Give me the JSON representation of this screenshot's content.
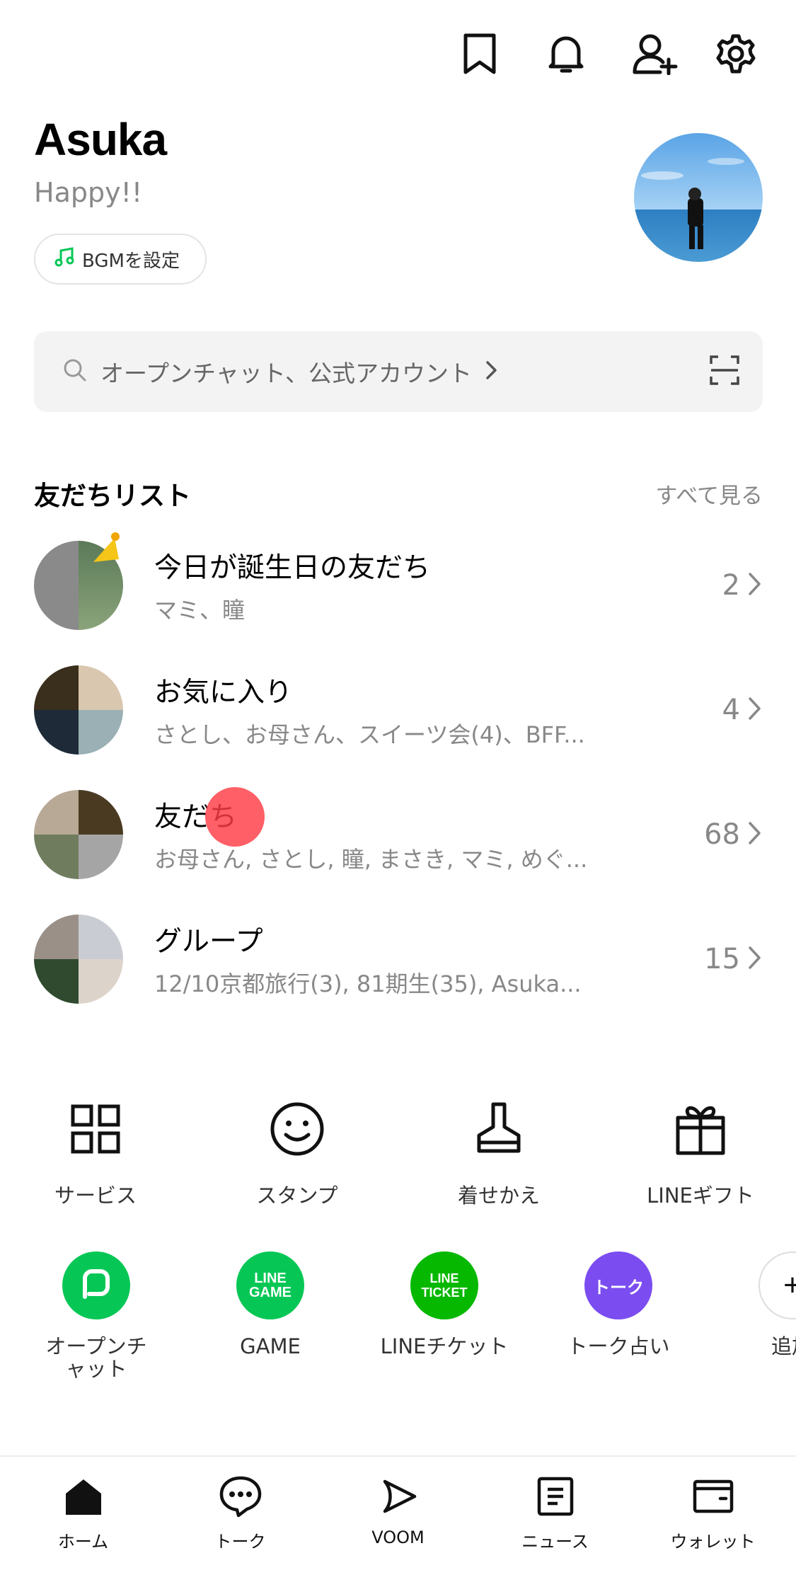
{
  "header": {
    "icons": [
      "bookmark-icon",
      "bell-icon",
      "add-friend-icon",
      "gear-icon"
    ]
  },
  "profile": {
    "name": "Asuka",
    "status": "Happy!!",
    "bgm_label": "BGMを設定"
  },
  "search": {
    "text": "オープンチャット、公式アカウント"
  },
  "friends_section": {
    "title": "友だちリスト",
    "see_all": "すべて見る",
    "rows": [
      {
        "name": "今日が誕生日の友だち",
        "sub": "マミ、瞳",
        "count": "2"
      },
      {
        "name": "お気に入り",
        "sub": "さとし、お母さん、スイーツ会(4)、BFF...",
        "count": "4"
      },
      {
        "name": "友だち",
        "sub": "お母さん, さとし, 瞳,  まさき, マミ,  めぐ...",
        "count": "68"
      },
      {
        "name": "グループ",
        "sub": "12/10京都旅行(3), 81期生(35), Asuka...",
        "count": "15"
      }
    ]
  },
  "menu": [
    {
      "label": "サービス",
      "icon": "grid-icon"
    },
    {
      "label": "スタンプ",
      "icon": "smile-icon"
    },
    {
      "label": "着せかえ",
      "icon": "brush-icon"
    },
    {
      "label": "LINEギフト",
      "icon": "gift-icon"
    }
  ],
  "apps": [
    {
      "label_line1": "オープンチ",
      "label_line2": "ャット",
      "badge": "",
      "color": "#06C755"
    },
    {
      "label_line1": "GAME",
      "label_line2": "",
      "badge_line1": "LINE",
      "badge_line2": "GAME",
      "color": "#06C755"
    },
    {
      "label_line1": "LINEチケット",
      "label_line2": "",
      "badge_line1": "LINE",
      "badge_line2": "TICKET",
      "color": "#06B800"
    },
    {
      "label_line1": "トーク占い",
      "label_line2": "",
      "badge": "トーク",
      "color": "#7B4DF0"
    },
    {
      "label_line1": "追加",
      "label_line2": "",
      "badge": "+",
      "color": "#ffffff"
    }
  ],
  "bottom_nav": [
    {
      "label": "ホーム",
      "icon": "home-icon",
      "active": true
    },
    {
      "label": "トーク",
      "icon": "chat-icon"
    },
    {
      "label": "VOOM",
      "icon": "voom-icon"
    },
    {
      "label": "ニュース",
      "icon": "news-icon"
    },
    {
      "label": "ウォレット",
      "icon": "wallet-icon"
    }
  ],
  "colors": {
    "accent_green": "#06C755",
    "text_gray": "#888888"
  }
}
